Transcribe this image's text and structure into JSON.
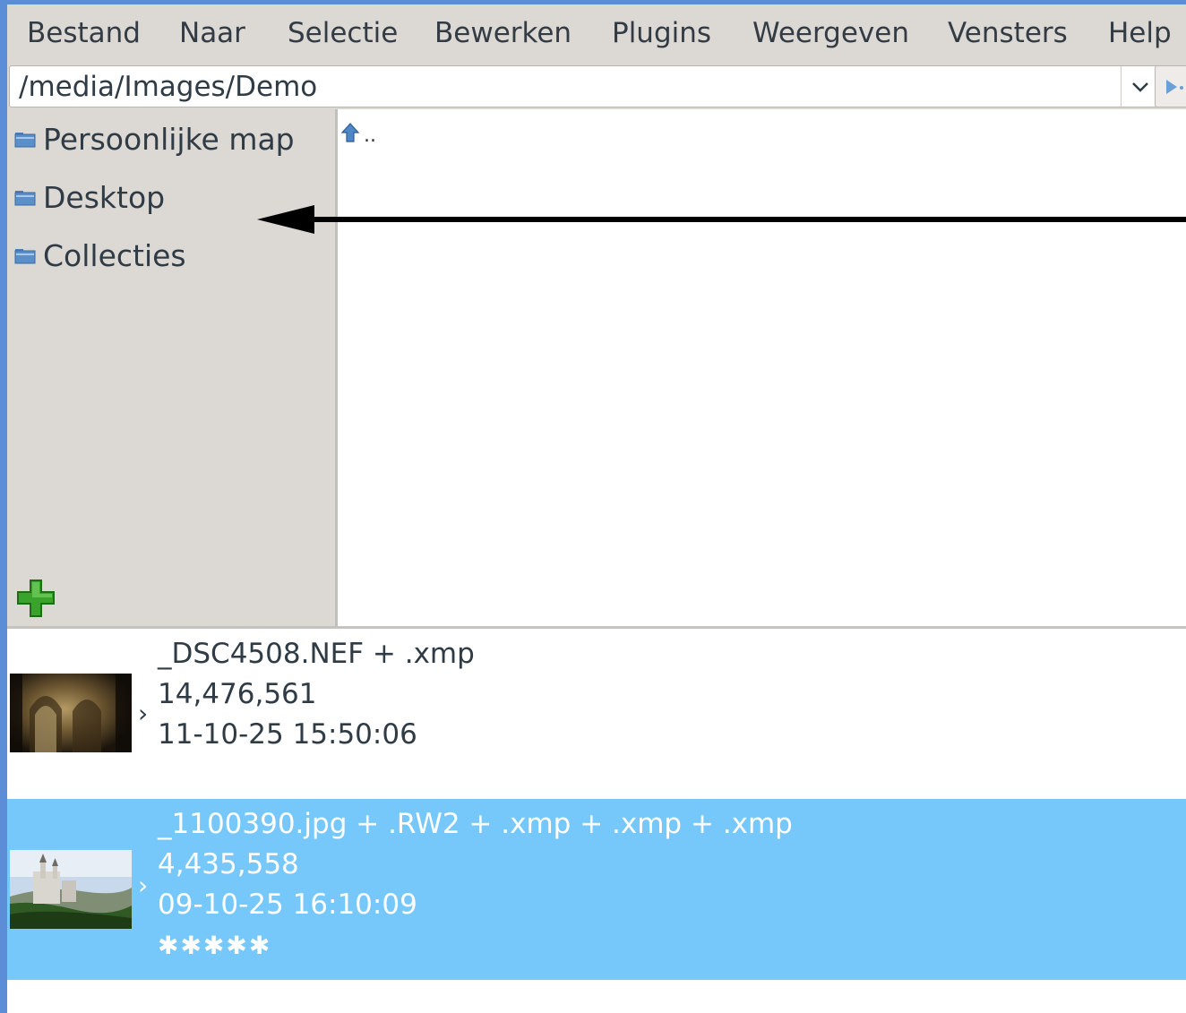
{
  "menubar": {
    "items": [
      "Bestand",
      "Naar",
      "Selectie",
      "Bewerken",
      "Plugins",
      "Weergeven",
      "Vensters",
      "Help"
    ]
  },
  "pathbar": {
    "path": "/media/Images/Demo",
    "dropdown_icon": "chevron-down-icon",
    "go_icon": "go-arrow-icon"
  },
  "sidebar": {
    "items": [
      {
        "label": "Persoonlijke map",
        "icon": "folder-icon"
      },
      {
        "label": "Desktop",
        "icon": "folder-icon"
      },
      {
        "label": "Collecties",
        "icon": "folder-icon"
      }
    ],
    "add_icon": "green-plus-icon"
  },
  "dirlist": {
    "entries": [
      {
        "label": "..",
        "icon": "up-arrow-icon"
      }
    ]
  },
  "files": [
    {
      "name": "_DSC4508.NEF + .xmp",
      "size": "14,476,561",
      "date": "11-10-25 15:50:06",
      "rating": "",
      "selected": false,
      "thumbnail": "interior-church-thumbnail"
    },
    {
      "name": "_1100390.jpg + .RW2 + .xmp + .xmp + .xmp",
      "size": "4,435,558",
      "date": "09-10-25 16:10:09",
      "rating": "✱✱✱✱✱",
      "selected": true,
      "thumbnail": "castle-thumbnail"
    }
  ],
  "colors": {
    "frame": "#5b8ed6",
    "panel_bg": "#dcd8d4",
    "selection": "#77c8fa",
    "text": "#2f3b45"
  }
}
